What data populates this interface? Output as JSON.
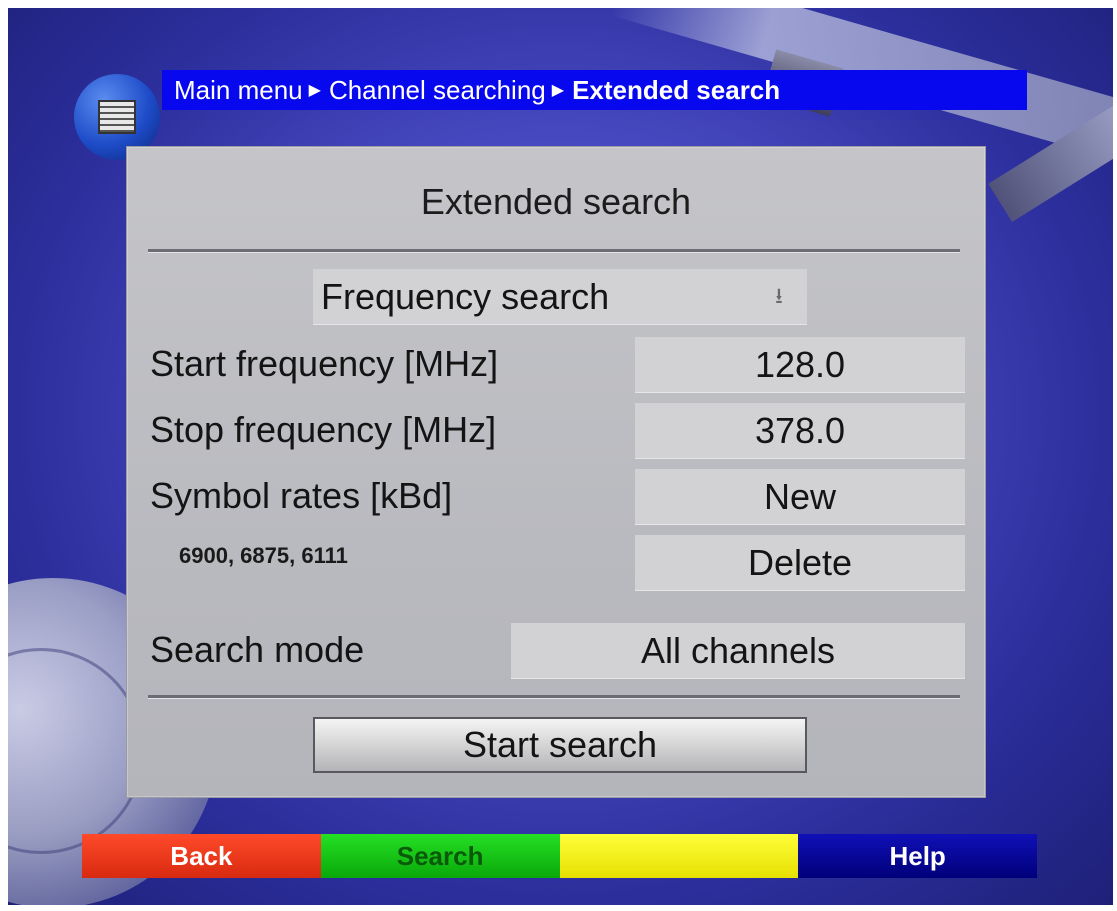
{
  "breadcrumb": {
    "items": [
      "Main menu",
      "Channel searching"
    ],
    "current": "Extended search",
    "separator": "▶"
  },
  "icons": {
    "menu_icon": "menu-screen-icon",
    "dropdown_arrow": "dropdown-arrow-icon"
  },
  "panel": {
    "title": "Extended search",
    "search_type": "Frequency search",
    "dropdown_glyph": "⭳",
    "rows": {
      "start_frequency": {
        "label": "Start frequency [MHz]",
        "value": "128.0"
      },
      "stop_frequency": {
        "label": "Stop frequency [MHz]",
        "value": "378.0"
      },
      "symbol_rates": {
        "label": "Symbol rates [kBd]",
        "new_button": "New"
      },
      "symbol_rates_list": {
        "label": "6900, 6875, 6111",
        "delete_button": "Delete"
      },
      "search_mode": {
        "label": "Search mode",
        "value": "All channels"
      }
    },
    "start_button": "Start search"
  },
  "color_bar": {
    "red": "Back",
    "green": "Search",
    "yellow": "",
    "blue": "Help"
  },
  "colors": {
    "breadcrumb_bg": "#0808ee",
    "panel_bg": "#c5c5c9",
    "field_bg": "#d2d2d4",
    "red": "#e83418",
    "green": "#14c414",
    "yellow": "#f4f014",
    "blue": "#0808a0"
  }
}
